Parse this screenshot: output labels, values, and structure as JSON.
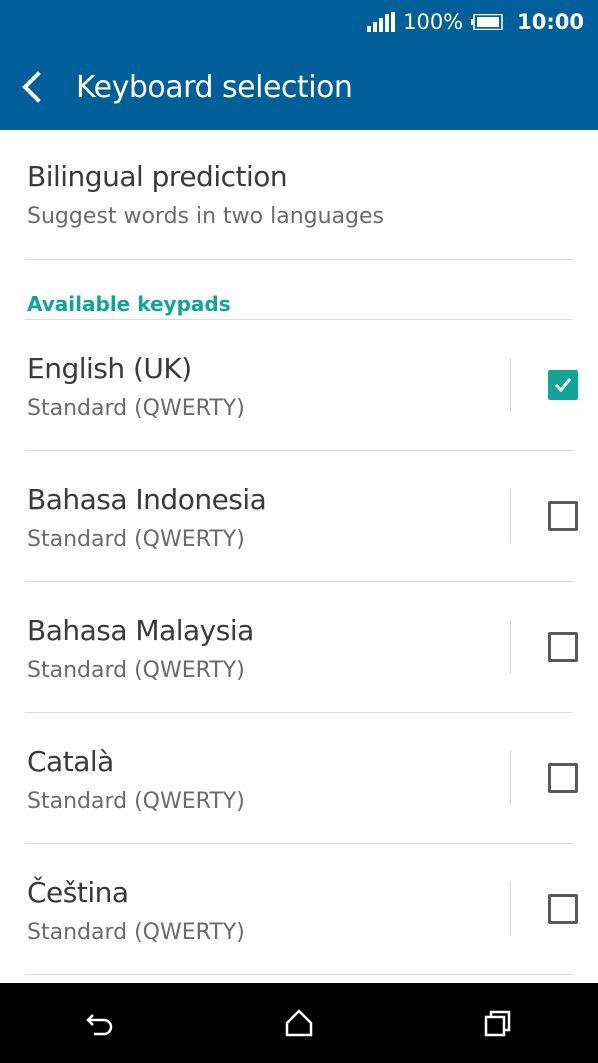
{
  "status": {
    "battery_percent": "100%",
    "time": "10:00"
  },
  "header": {
    "title": "Keyboard selection"
  },
  "bilingual": {
    "title": "Bilingual prediction",
    "subtitle": "Suggest words in two languages"
  },
  "section": {
    "title": "Available keypads"
  },
  "keypads": [
    {
      "language": "English (UK)",
      "layout": "Standard (QWERTY)",
      "checked": true
    },
    {
      "language": "Bahasa Indonesia",
      "layout": "Standard (QWERTY)",
      "checked": false
    },
    {
      "language": "Bahasa Malaysia",
      "layout": "Standard (QWERTY)",
      "checked": false
    },
    {
      "language": "Català",
      "layout": "Standard (QWERTY)",
      "checked": false
    },
    {
      "language": "Čeština",
      "layout": "Standard (QWERTY)",
      "checked": false
    }
  ],
  "colors": {
    "appbar": "#005f98",
    "accent": "#12a49a"
  },
  "navbar": {
    "icons": [
      "back-icon",
      "home-icon",
      "recent-apps-icon"
    ]
  }
}
